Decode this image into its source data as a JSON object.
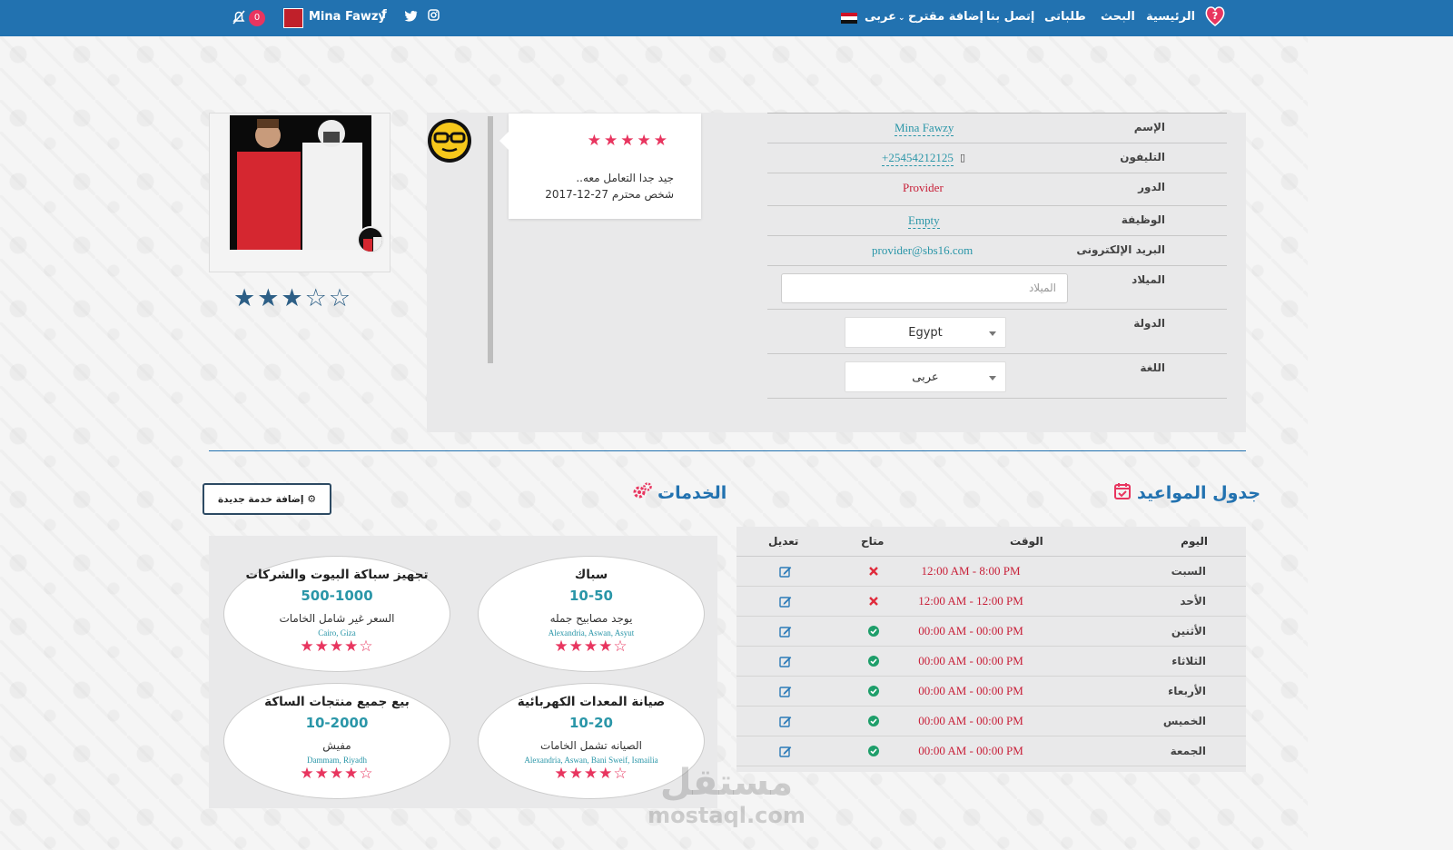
{
  "nav": {
    "items": [
      "الرئيسية",
      "البحث",
      "طلباتى",
      "إتصل بنا",
      "إضافة مقترح",
      "عربى"
    ],
    "user_name": "Mina Fawzy",
    "notifications": "0",
    "social": [
      "facebook-icon",
      "twitter-icon",
      "instagram-icon"
    ]
  },
  "review": {
    "stars": "★★★★★",
    "text": "جيد جدا التعامل معه..",
    "author_date": "شخص محترم 27-12-2017"
  },
  "profile": {
    "user_stars": "★★★☆☆",
    "fields": [
      {
        "label": "الإسم",
        "value": "Mina Fawzy"
      },
      {
        "label": "التليفون",
        "value": "+25454212125"
      },
      {
        "label": "الدور",
        "value": "Provider"
      },
      {
        "label": "الوظيفة",
        "value": "Empty"
      },
      {
        "label": "البريد الإلكترونى",
        "value": "provider@sbs16.com"
      },
      {
        "label": "الميلاد",
        "placeholder": "الميلاد"
      },
      {
        "label": "الدولة",
        "value": "Egypt"
      },
      {
        "label": "اللغة",
        "value": "عربى"
      }
    ]
  },
  "schedule": {
    "title": "جدول المواعيد",
    "headers": [
      "اليوم",
      "الوقت",
      "متاح",
      "تعديل"
    ],
    "rows": [
      {
        "day": "السبت",
        "time": "12:00 AM - 8:00 PM",
        "available": false
      },
      {
        "day": "الأحد",
        "time": "12:00 AM - 12:00 PM",
        "available": false
      },
      {
        "day": "الأثنين",
        "time": "00:00 AM - 00:00 PM",
        "available": true
      },
      {
        "day": "الثلاثاء",
        "time": "00:00 AM - 00:00 PM",
        "available": true
      },
      {
        "day": "الأربعاء",
        "time": "00:00 AM - 00:00 PM",
        "available": true
      },
      {
        "day": "الخميس",
        "time": "00:00 AM - 00:00 PM",
        "available": true
      },
      {
        "day": "الجمعة",
        "time": "00:00 AM - 00:00 PM",
        "available": true
      }
    ]
  },
  "services": {
    "title": "الخدمات",
    "add_button": "إضافة خدمة جديدة",
    "items": [
      {
        "title": "سباك",
        "price": "10-50",
        "desc": "يوجد مصابيح جمله",
        "locations": "Alexandria, Aswan, Asyut",
        "stars": "★★★★☆"
      },
      {
        "title": "تجهيز سباكة البيوت والشركات",
        "price": "500-1000",
        "desc": "السعر غير شامل الخامات",
        "locations": "Cairo, Giza",
        "stars": "★★★★☆"
      },
      {
        "title": "صيانة المعدات الكهربائية",
        "price": "10-20",
        "desc": "الصيانه تشمل الخامات",
        "locations": "Alexandria, Aswan, Bani Sweif, Ismailia",
        "stars": "★★★★☆"
      },
      {
        "title": "بيع جميع منتجات الساكة",
        "price": "10-2000",
        "desc": "مفيش",
        "locations": "Dammam, Riyadh",
        "stars": "★★★★☆"
      }
    ]
  },
  "watermark": {
    "arabic": "مستقل",
    "latin": "mostaql.com"
  },
  "colors": {
    "nav": "#2272b0",
    "accent": "#e8355f",
    "teal": "#2a96a8",
    "red_text": "#c81f38"
  }
}
